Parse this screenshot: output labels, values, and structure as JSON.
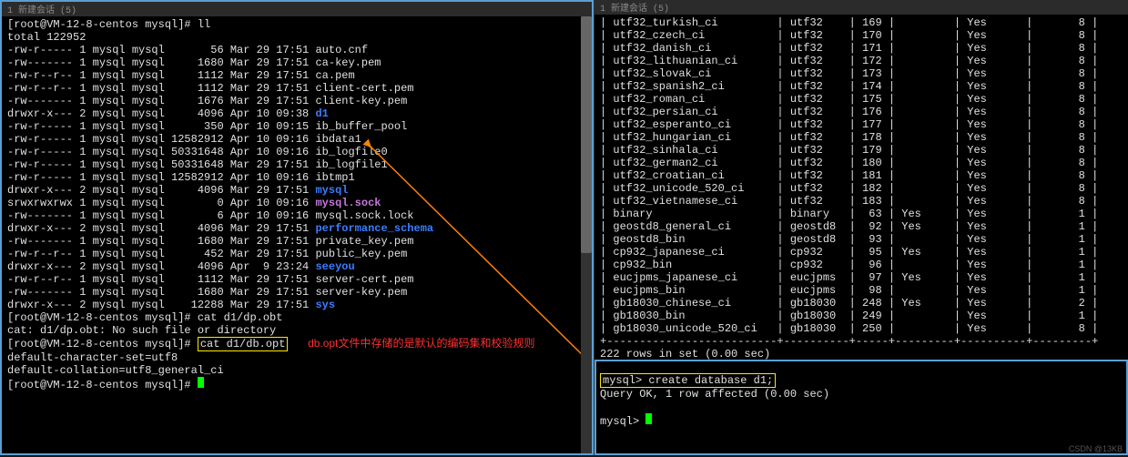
{
  "left": {
    "title": "1 新建会话 (5) ",
    "prompt1": "[root@VM-12-8-centos mysql]#",
    "cmd_ll": "ll",
    "total": "total 122952",
    "files": [
      {
        "perm": "-rw-r-----",
        "n": "1",
        "owner": "mysql mysql",
        "size": "56",
        "date": "Mar 29 17:51",
        "name": "auto.cnf",
        "cls": "white"
      },
      {
        "perm": "-rw-------",
        "n": "1",
        "owner": "mysql mysql",
        "size": "1680",
        "date": "Mar 29 17:51",
        "name": "ca-key.pem",
        "cls": "white"
      },
      {
        "perm": "-rw-r--r--",
        "n": "1",
        "owner": "mysql mysql",
        "size": "1112",
        "date": "Mar 29 17:51",
        "name": "ca.pem",
        "cls": "white"
      },
      {
        "perm": "-rw-r--r--",
        "n": "1",
        "owner": "mysql mysql",
        "size": "1112",
        "date": "Mar 29 17:51",
        "name": "client-cert.pem",
        "cls": "white"
      },
      {
        "perm": "-rw-------",
        "n": "1",
        "owner": "mysql mysql",
        "size": "1676",
        "date": "Mar 29 17:51",
        "name": "client-key.pem",
        "cls": "white"
      },
      {
        "perm": "drwxr-x---",
        "n": "2",
        "owner": "mysql mysql",
        "size": "4096",
        "date": "Apr 10 09:38",
        "name": "d1",
        "cls": "dir-blue"
      },
      {
        "perm": "-rw-r-----",
        "n": "1",
        "owner": "mysql mysql",
        "size": "350",
        "date": "Apr 10 09:15",
        "name": "ib_buffer_pool",
        "cls": "white"
      },
      {
        "perm": "-rw-r-----",
        "n": "1",
        "owner": "mysql mysql",
        "size": "12582912",
        "date": "Apr 10 09:16",
        "name": "ibdata1",
        "cls": "white"
      },
      {
        "perm": "-rw-r-----",
        "n": "1",
        "owner": "mysql mysql",
        "size": "50331648",
        "date": "Apr 10 09:16",
        "name": "ib_logfile0",
        "cls": "white"
      },
      {
        "perm": "-rw-r-----",
        "n": "1",
        "owner": "mysql mysql",
        "size": "50331648",
        "date": "Mar 29 17:51",
        "name": "ib_logfile1",
        "cls": "white"
      },
      {
        "perm": "-rw-r-----",
        "n": "1",
        "owner": "mysql mysql",
        "size": "12582912",
        "date": "Apr 10 09:16",
        "name": "ibtmp1",
        "cls": "white"
      },
      {
        "perm": "drwxr-x---",
        "n": "2",
        "owner": "mysql mysql",
        "size": "4096",
        "date": "Mar 29 17:51",
        "name": "mysql",
        "cls": "dir-blue"
      },
      {
        "perm": "srwxrwxrwx",
        "n": "1",
        "owner": "mysql mysql",
        "size": "0",
        "date": "Apr 10 09:16",
        "name": "mysql.sock",
        "cls": "magenta"
      },
      {
        "perm": "-rw-------",
        "n": "1",
        "owner": "mysql mysql",
        "size": "6",
        "date": "Apr 10 09:16",
        "name": "mysql.sock.lock",
        "cls": "white"
      },
      {
        "perm": "drwxr-x---",
        "n": "2",
        "owner": "mysql mysql",
        "size": "4096",
        "date": "Mar 29 17:51",
        "name": "performance_schema",
        "cls": "dir-blue"
      },
      {
        "perm": "-rw-------",
        "n": "1",
        "owner": "mysql mysql",
        "size": "1680",
        "date": "Mar 29 17:51",
        "name": "private_key.pem",
        "cls": "white"
      },
      {
        "perm": "-rw-r--r--",
        "n": "1",
        "owner": "mysql mysql",
        "size": "452",
        "date": "Mar 29 17:51",
        "name": "public_key.pem",
        "cls": "white"
      },
      {
        "perm": "drwxr-x---",
        "n": "2",
        "owner": "mysql mysql",
        "size": "4096",
        "date": "Apr  9 23:24",
        "name": "seeyou",
        "cls": "dir-blue"
      },
      {
        "perm": "-rw-r--r--",
        "n": "1",
        "owner": "mysql mysql",
        "size": "1112",
        "date": "Mar 29 17:51",
        "name": "server-cert.pem",
        "cls": "white"
      },
      {
        "perm": "-rw-------",
        "n": "1",
        "owner": "mysql mysql",
        "size": "1680",
        "date": "Mar 29 17:51",
        "name": "server-key.pem",
        "cls": "white"
      },
      {
        "perm": "drwxr-x---",
        "n": "2",
        "owner": "mysql mysql",
        "size": "12288",
        "date": "Mar 29 17:51",
        "name": "sys",
        "cls": "dir-blue"
      }
    ],
    "cmd_cat1": "cat d1/dp.obt",
    "err": "cat: d1/dp.obt: No such file or directory",
    "cmd_cat2": "cat d1/db.opt",
    "out1": "default-character-set=utf8",
    "out2": "default-collation=utf8_general_ci",
    "annotation": "db.opt文件中存储的是默认的编码集和校验规则"
  },
  "right": {
    "title": "1 新建会话 (5) ",
    "rows": [
      {
        "c1": "utf32_turkish_ci",
        "c2": "utf32",
        "c3": "169",
        "c4": "",
        "c5": "Yes",
        "c6": "8"
      },
      {
        "c1": "utf32_czech_ci",
        "c2": "utf32",
        "c3": "170",
        "c4": "",
        "c5": "Yes",
        "c6": "8"
      },
      {
        "c1": "utf32_danish_ci",
        "c2": "utf32",
        "c3": "171",
        "c4": "",
        "c5": "Yes",
        "c6": "8"
      },
      {
        "c1": "utf32_lithuanian_ci",
        "c2": "utf32",
        "c3": "172",
        "c4": "",
        "c5": "Yes",
        "c6": "8"
      },
      {
        "c1": "utf32_slovak_ci",
        "c2": "utf32",
        "c3": "173",
        "c4": "",
        "c5": "Yes",
        "c6": "8"
      },
      {
        "c1": "utf32_spanish2_ci",
        "c2": "utf32",
        "c3": "174",
        "c4": "",
        "c5": "Yes",
        "c6": "8"
      },
      {
        "c1": "utf32_roman_ci",
        "c2": "utf32",
        "c3": "175",
        "c4": "",
        "c5": "Yes",
        "c6": "8"
      },
      {
        "c1": "utf32_persian_ci",
        "c2": "utf32",
        "c3": "176",
        "c4": "",
        "c5": "Yes",
        "c6": "8"
      },
      {
        "c1": "utf32_esperanto_ci",
        "c2": "utf32",
        "c3": "177",
        "c4": "",
        "c5": "Yes",
        "c6": "8"
      },
      {
        "c1": "utf32_hungarian_ci",
        "c2": "utf32",
        "c3": "178",
        "c4": "",
        "c5": "Yes",
        "c6": "8"
      },
      {
        "c1": "utf32_sinhala_ci",
        "c2": "utf32",
        "c3": "179",
        "c4": "",
        "c5": "Yes",
        "c6": "8"
      },
      {
        "c1": "utf32_german2_ci",
        "c2": "utf32",
        "c3": "180",
        "c4": "",
        "c5": "Yes",
        "c6": "8"
      },
      {
        "c1": "utf32_croatian_ci",
        "c2": "utf32",
        "c3": "181",
        "c4": "",
        "c5": "Yes",
        "c6": "8"
      },
      {
        "c1": "utf32_unicode_520_ci",
        "c2": "utf32",
        "c3": "182",
        "c4": "",
        "c5": "Yes",
        "c6": "8"
      },
      {
        "c1": "utf32_vietnamese_ci",
        "c2": "utf32",
        "c3": "183",
        "c4": "",
        "c5": "Yes",
        "c6": "8"
      },
      {
        "c1": "binary",
        "c2": "binary",
        "c3": "63",
        "c4": "Yes",
        "c5": "Yes",
        "c6": "1"
      },
      {
        "c1": "geostd8_general_ci",
        "c2": "geostd8",
        "c3": "92",
        "c4": "Yes",
        "c5": "Yes",
        "c6": "1"
      },
      {
        "c1": "geostd8_bin",
        "c2": "geostd8",
        "c3": "93",
        "c4": "",
        "c5": "Yes",
        "c6": "1"
      },
      {
        "c1": "cp932_japanese_ci",
        "c2": "cp932",
        "c3": "95",
        "c4": "Yes",
        "c5": "Yes",
        "c6": "1"
      },
      {
        "c1": "cp932_bin",
        "c2": "cp932",
        "c3": "96",
        "c4": "",
        "c5": "Yes",
        "c6": "1"
      },
      {
        "c1": "eucjpms_japanese_ci",
        "c2": "eucjpms",
        "c3": "97",
        "c4": "Yes",
        "c5": "Yes",
        "c6": "1"
      },
      {
        "c1": "eucjpms_bin",
        "c2": "eucjpms",
        "c3": "98",
        "c4": "",
        "c5": "Yes",
        "c6": "1"
      },
      {
        "c1": "gb18030_chinese_ci",
        "c2": "gb18030",
        "c3": "248",
        "c4": "Yes",
        "c5": "Yes",
        "c6": "2"
      },
      {
        "c1": "gb18030_bin",
        "c2": "gb18030",
        "c3": "249",
        "c4": "",
        "c5": "Yes",
        "c6": "1"
      },
      {
        "c1": "gb18030_unicode_520_ci",
        "c2": "gb18030",
        "c3": "250",
        "c4": "",
        "c5": "Yes",
        "c6": "8"
      }
    ],
    "sep": "+--------------------------+----------+-----+---------+----------+---------+",
    "summary": "222 rows in set (0.00 sec)",
    "mysql_prompt": "mysql>",
    "sql": "create database d1;",
    "result": "Query OK, 1 row affected (0.00 sec)"
  },
  "watermark": "CSDN @13KB"
}
